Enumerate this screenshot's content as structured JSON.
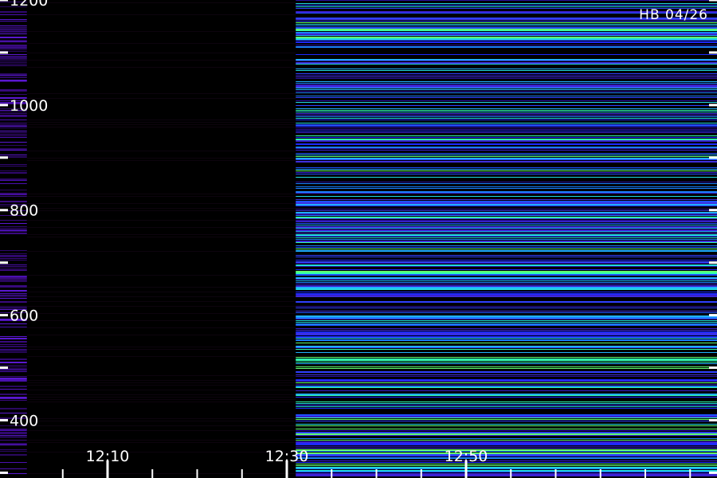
{
  "chart_data": {
    "type": "heatmap",
    "title": "HB 04/26",
    "xlabel": "",
    "ylabel": "",
    "x_range_minutes": [
      1198,
      1278
    ],
    "x_ticks": [
      {
        "t": 1210,
        "label": "12:10"
      },
      {
        "t": 1230,
        "label": "12:30"
      },
      {
        "t": 1250,
        "label": "12:50"
      }
    ],
    "x_minor_ticks": [
      1205,
      1215,
      1220,
      1225,
      1235,
      1240,
      1245,
      1255,
      1260,
      1265,
      1270,
      1275
    ],
    "ylim": [
      290,
      1200
    ],
    "y_ticks": [
      {
        "v": 400,
        "label": "400"
      },
      {
        "v": 600,
        "label": "600"
      },
      {
        "v": 800,
        "label": "800"
      },
      {
        "v": 1000,
        "label": "1000"
      },
      {
        "v": 1200,
        "label": "1200"
      }
    ],
    "y_minor_ticks": [
      300,
      500,
      700,
      900,
      1100
    ],
    "segments": [
      {
        "name": "",
        "t_start": 1198,
        "t_end": 1201,
        "level": "medium"
      },
      {
        "name": "",
        "t_start": 1201,
        "t_end": 1231,
        "level": "none"
      },
      {
        "name": "",
        "t_start": 1231,
        "t_end": 1278,
        "level": "high"
      }
    ],
    "colorscale": [
      "#000000",
      "#2a0060",
      "#4a10c0",
      "#3040ff",
      "#20a0ff",
      "#30ffc0",
      "#80ff60"
    ]
  }
}
